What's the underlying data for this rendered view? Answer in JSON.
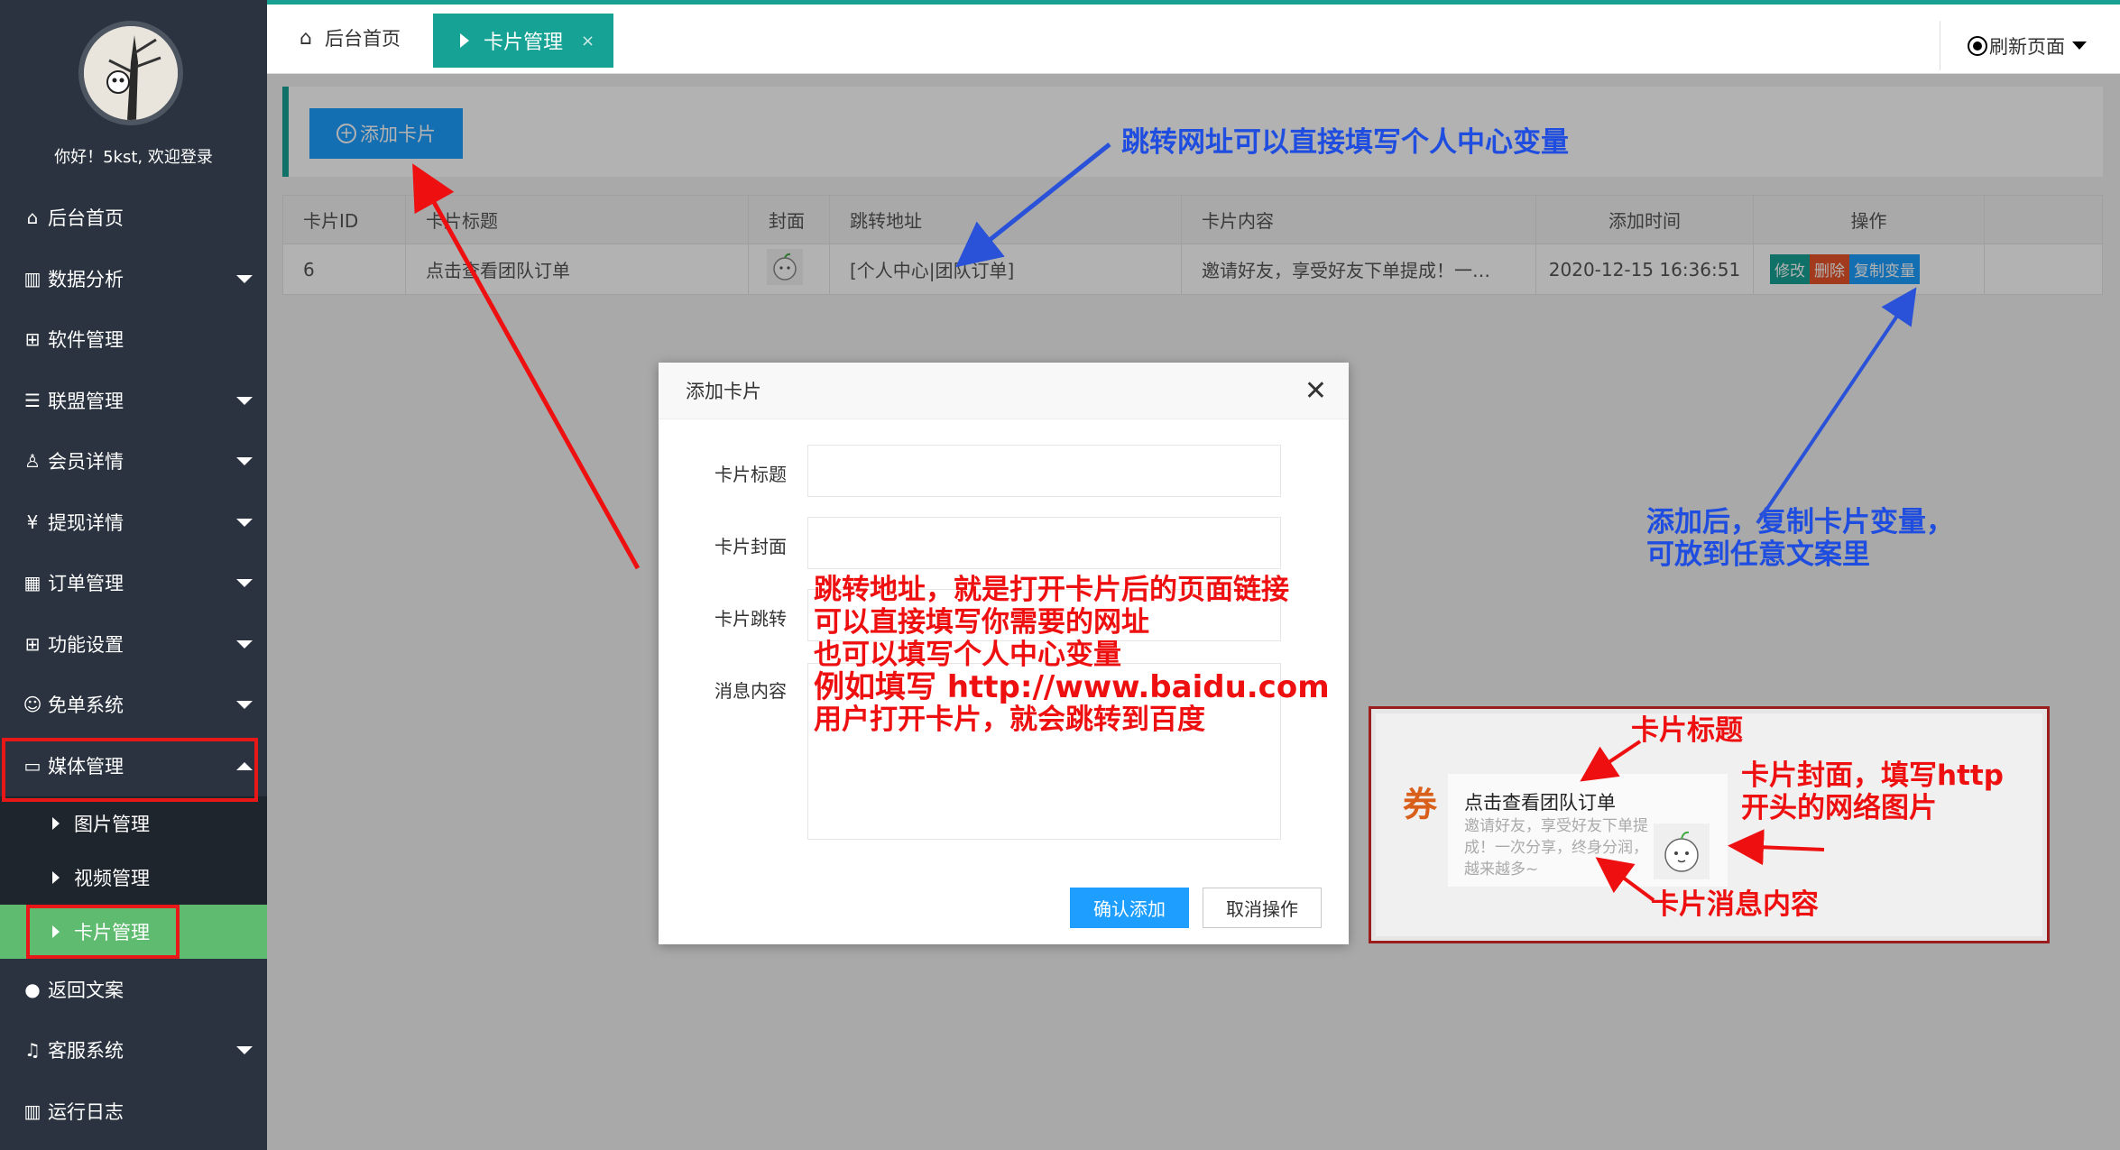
{
  "sidebar": {
    "greeting": "你好！5kst, 欢迎登录",
    "items": [
      {
        "label": "后台首页",
        "icon": "home-icon"
      },
      {
        "label": "数据分析",
        "icon": "chart-icon"
      },
      {
        "label": "软件管理",
        "icon": "apps-icon"
      },
      {
        "label": "联盟管理",
        "icon": "list-icon"
      },
      {
        "label": "会员详情",
        "icon": "user-icon"
      },
      {
        "label": "提现详情",
        "icon": "yen-icon"
      },
      {
        "label": "订单管理",
        "icon": "grid-icon"
      },
      {
        "label": "功能设置",
        "icon": "apps-icon"
      },
      {
        "label": "免单系统",
        "icon": "gift-icon"
      },
      {
        "label": "媒体管理",
        "icon": "image-icon"
      },
      {
        "label": "返回文案",
        "icon": "chat-icon"
      },
      {
        "label": "客服系统",
        "icon": "bell-icon"
      },
      {
        "label": "运行日志",
        "icon": "log-icon"
      }
    ],
    "submenu": [
      {
        "label": "图片管理"
      },
      {
        "label": "视频管理"
      },
      {
        "label": "卡片管理"
      }
    ]
  },
  "topbar": {
    "home_tab": "后台首页",
    "active_tab": "卡片管理",
    "close_glyph": "×",
    "refresh": "刷新页面"
  },
  "toolbar": {
    "add_label": "添加卡片"
  },
  "table": {
    "headers": [
      "卡片ID",
      "卡片标题",
      "封面",
      "跳转地址",
      "卡片内容",
      "添加时间",
      "操作"
    ],
    "rows": [
      {
        "id": "6",
        "title": "点击查看团队订单",
        "url": "[个人中心|团队订单]",
        "content": "邀请好友，享受好友下单提成！一…",
        "time": "2020-12-15 16:36:51",
        "ops": [
          "修改",
          "删除",
          "复制变量"
        ]
      }
    ]
  },
  "modal": {
    "title": "添加卡片",
    "close_glyph": "✕",
    "fields": [
      "卡片标题",
      "卡片封面",
      "卡片跳转",
      "消息内容"
    ],
    "confirm": "确认添加",
    "cancel": "取消操作"
  },
  "annotations": {
    "blue_top": "跳转网址可以直接填写个人中心变量",
    "blue_right": [
      "添加后，复制卡片变量，",
      "可放到任意文案里"
    ],
    "red_modal": [
      "跳转地址，就是打开卡片后的页面链接",
      "可以直接填写你需要的网址",
      "也可以填写个人中心变量",
      "例如填写 http://www.baidu.com",
      "用户打开卡片，就会跳转到百度"
    ],
    "preview_title_label": "卡片标题",
    "preview_cover_label": [
      "卡片封面，填写http",
      "开头的网络图片"
    ],
    "preview_msg_label": "卡片消息内容"
  },
  "preview": {
    "coupon": "券",
    "title": "点击查看团队订单",
    "message": "邀请好友，享受好友下单提成！一次分享，终身分润，越来越多~"
  },
  "colors": {
    "sidebar_bg": "#2a333f",
    "accent": "#16a295",
    "primary_btn": "#1e9fff",
    "active_sub": "#5fbb6f",
    "annotation_red": "#ee1010",
    "annotation_blue": "#1f4de0"
  }
}
